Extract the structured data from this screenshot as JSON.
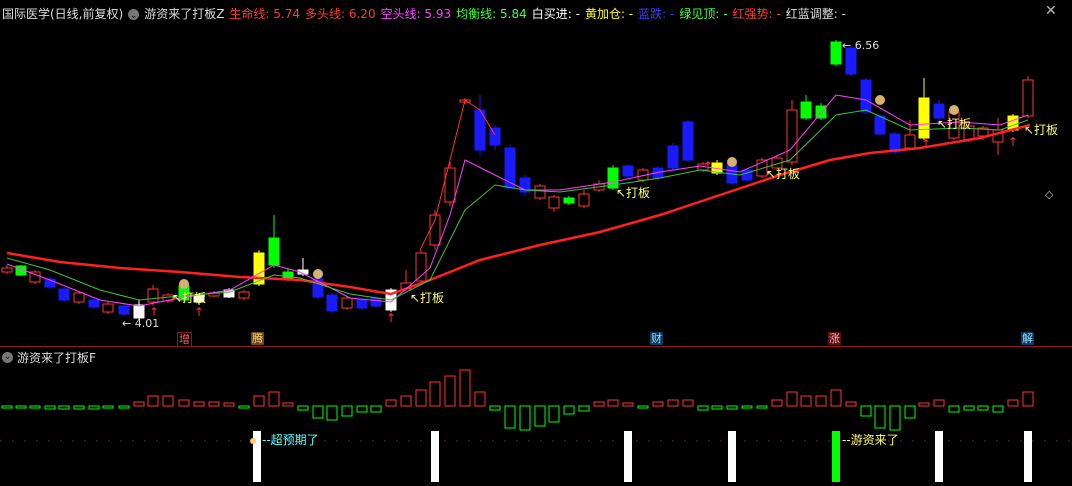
{
  "header": {
    "title": "国际医学(日线,前复权)",
    "indicator_name": "游资来了打板Z",
    "indicators": [
      {
        "label": "生命线:",
        "value": "5.74",
        "color": "#ff3b3b"
      },
      {
        "label": "多头线:",
        "value": "6.20",
        "color": "#ff3b3b"
      },
      {
        "label": "空头线:",
        "value": "5.93",
        "color": "#ff40ff"
      },
      {
        "label": "均衡线:",
        "value": "5.84",
        "color": "#40ff40"
      },
      {
        "label": "白买进:",
        "value": "-",
        "color": "#ffffff"
      },
      {
        "label": "黄加仓:",
        "value": "-",
        "color": "#ffff00"
      },
      {
        "label": "蓝跌:",
        "value": "-",
        "color": "#3c3cff"
      },
      {
        "label": "绿见顶:",
        "value": "-",
        "color": "#40ff40"
      },
      {
        "label": "红强势:",
        "value": "-",
        "color": "#ff3b3b"
      },
      {
        "label": "红蓝调整:",
        "value": "-",
        "color": "#dddddd"
      }
    ],
    "close_glyph": "✕",
    "expand_glyph": "◇"
  },
  "main": {
    "annotations": {
      "high_label": "6.56",
      "low_label": "4.01",
      "board_label": "打板"
    },
    "bottom_tags": [
      "增",
      "腾",
      "财",
      "涨",
      "解"
    ]
  },
  "sub": {
    "indicator_name": "游资来了打板F",
    "labels": [
      "超预期了",
      "游资来了"
    ]
  },
  "colors": {
    "up": "#ff3333",
    "down": "#00ffff",
    "blue": "#1a1aff",
    "white": "#ffffff",
    "yellow": "#ffff00",
    "green": "#00ff00",
    "life_line": "#ff2020",
    "pink": "#ff40ff",
    "mid_green": "#40c040"
  }
}
